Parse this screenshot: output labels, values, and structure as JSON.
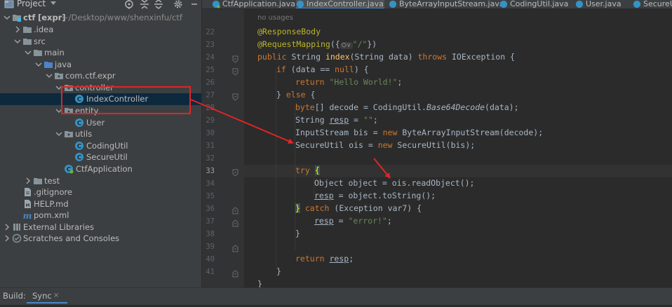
{
  "project_panel": {
    "title": "Project",
    "tree": [
      {
        "label": "ctf",
        "suffix": "[expr]",
        "path": "~/Desktop/www/shenxinfu/ctf",
        "icon": "module-folder-icon"
      },
      {
        "label": ".idea",
        "icon": "folder-icon"
      },
      {
        "label": "src",
        "icon": "folder-icon"
      },
      {
        "label": "main",
        "icon": "folder-icon"
      },
      {
        "label": "java",
        "icon": "source-folder-icon"
      },
      {
        "label": "com.ctf.expr",
        "icon": "package-icon"
      },
      {
        "label": "controller",
        "icon": "package-icon"
      },
      {
        "label": "IndexController",
        "icon": "java-class-icon"
      },
      {
        "label": "entity",
        "icon": "package-icon"
      },
      {
        "label": "User",
        "icon": "java-class-icon"
      },
      {
        "label": "utils",
        "icon": "package-icon"
      },
      {
        "label": "CodingUtil",
        "icon": "java-class-icon"
      },
      {
        "label": "SecureUtil",
        "icon": "java-class-icon"
      },
      {
        "label": "CtfApplication",
        "icon": "spring-class-icon"
      },
      {
        "label": "test",
        "icon": "folder-icon"
      },
      {
        "label": ".gitignore",
        "icon": "text-file-icon"
      },
      {
        "label": "HELP.md",
        "icon": "markdown-file-icon"
      },
      {
        "label": "pom.xml",
        "icon": "maven-file-icon"
      },
      {
        "label": "External Libraries",
        "icon": "library-icon"
      },
      {
        "label": "Scratches and Consoles",
        "icon": "scratches-icon"
      }
    ]
  },
  "tabs": [
    {
      "label": "CtfApplication.java",
      "active": false
    },
    {
      "label": "IndexController.java",
      "active": true
    },
    {
      "label": "ByteArrayInputStream.java",
      "active": false
    },
    {
      "label": "CodingUtil.java",
      "active": false
    },
    {
      "label": "User.java",
      "active": false
    },
    {
      "label": "SecureUti",
      "active": false
    }
  ],
  "editor": {
    "usages_hint": "no usages",
    "line_numbers": [
      "22",
      "23",
      "24",
      "25",
      "26",
      "27",
      "28",
      "29",
      "30",
      "31",
      "32",
      "33",
      "34",
      "35",
      "36",
      "37",
      "38",
      "39",
      "40",
      "41"
    ],
    "current_line": "33",
    "lines": {
      "l22_ann": "@ResponseBody",
      "l23_ann": "@RequestMapping",
      "l23_open": "({",
      "l23_hint": "⛭∨",
      "l23_str": "\"/\"",
      "l23_close": "})",
      "l24_kw1": "public",
      "l24_type": " String ",
      "l24_fn": "index",
      "l24_params": "(String data) ",
      "l24_kw2": "throws",
      "l24_rest": " IOException {",
      "l25_kw": "if",
      "l25_rest": " (data == ",
      "l25_null": "null",
      "l25_end": ") {",
      "l26_kw": "return",
      "l26_str": " \"Hello World!\"",
      "l26_end": ";",
      "l27_open": "} ",
      "l27_kw": "else",
      "l27_end": " {",
      "l28_kw": "byte",
      "l28_a": "[] decode = CodingUtil.",
      "l28_fn": "Base64Decode",
      "l28_b": "(data);",
      "l29_a": "String ",
      "l29_var": "resp",
      "l29_b": " = ",
      "l29_str": "\"\"",
      "l29_c": ";",
      "l30_a": "InputStream bis = ",
      "l30_kw": "new",
      "l30_b": " ByteArrayInputStream(decode);",
      "l31_a": "SecureUtil ois = ",
      "l31_kw": "new",
      "l31_b": " SecureUtil(bis);",
      "l33_kw": "try",
      "l33_brace": "{",
      "l34": "Object object = ois.readObject();",
      "l35_var": "resp",
      "l35_b": " = object.toString();",
      "l36_brace": "}",
      "l36_kw": " catch",
      "l36_b": " (Exception var7) {",
      "l37_var": "resp",
      "l37_b": " = ",
      "l37_str": "\"error!\"",
      "l37_c": ";",
      "l38": "}",
      "l40_kw": "return",
      "l40_sp": " ",
      "l40_var": "resp",
      "l40_c": ";",
      "l41": "}",
      "l42": "}"
    }
  },
  "bottom": {
    "build_label": "Build:",
    "sync_label": "Sync",
    "sync_close": "×"
  },
  "colors": {
    "annotation_box": "#e02525",
    "arrow": "#e02525",
    "selection": "#0d293e",
    "accent": "#4a88c7"
  }
}
